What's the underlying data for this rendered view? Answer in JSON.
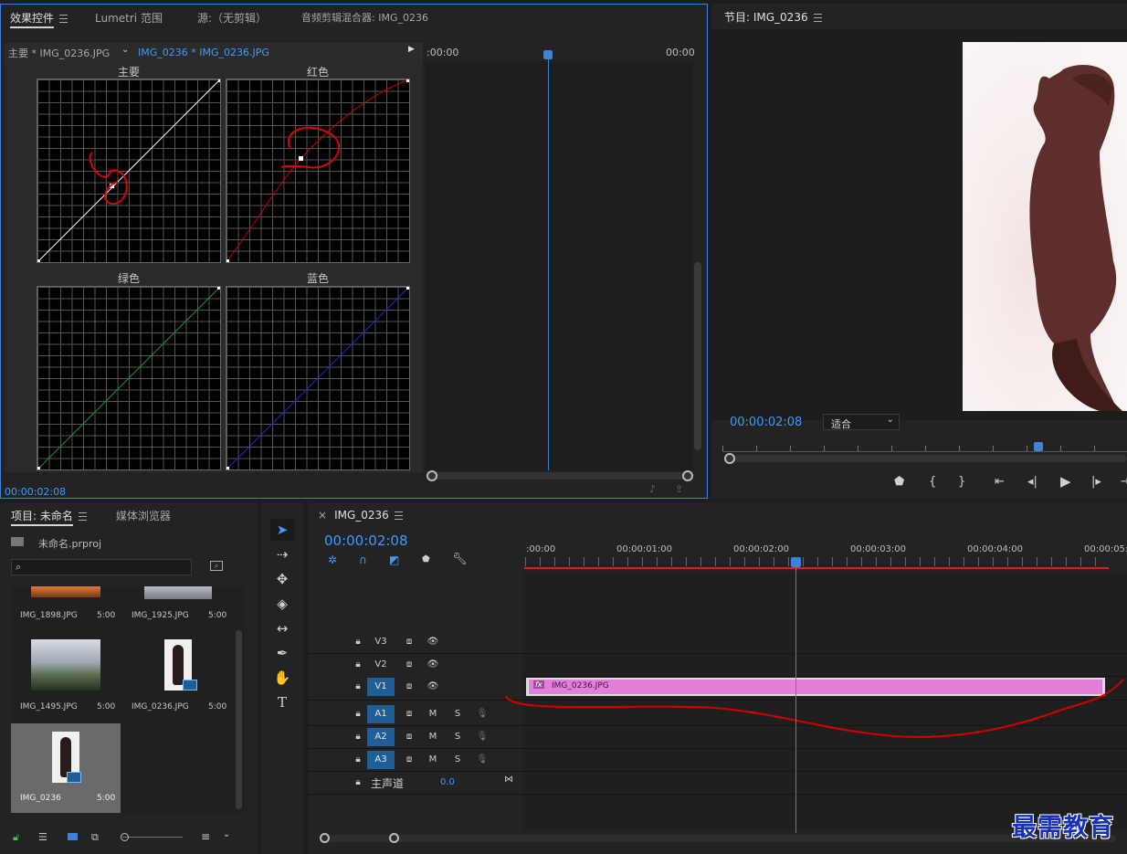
{
  "effects": {
    "tabs": [
      "效果控件",
      "Lumetri 范围",
      "源:（无剪辑）",
      "音频剪辑混合器: IMG_0236"
    ],
    "clip_master": "主要 * IMG_0236.JPG",
    "clip_selected": "IMG_0236 * IMG_0236.JPG",
    "time_left": ":00:00",
    "time_right": "00:00",
    "timecode": "00:00:02:08",
    "curves": {
      "master": "主要",
      "red": "红色",
      "green": "绿色",
      "blue": "蓝色"
    }
  },
  "program": {
    "title": "节目: IMG_0236",
    "timecode": "00:00:02:08",
    "fit_label": "适合"
  },
  "project": {
    "tabs": [
      "项目: 未命名",
      "媒体浏览器"
    ],
    "file": "未命名.prproj",
    "search_placeholder": "",
    "items": [
      {
        "name": "IMG_1898.JPG",
        "duration": "5:00"
      },
      {
        "name": "IMG_1925.JPG",
        "duration": "5:00"
      },
      {
        "name": "IMG_1495.JPG",
        "duration": "5:00"
      },
      {
        "name": "IMG_0236.JPG",
        "duration": "5:00"
      },
      {
        "name": "IMG_0236",
        "duration": "5:00"
      }
    ]
  },
  "timeline": {
    "tab": "IMG_0236",
    "close": "×",
    "timecode": "00:00:02:08",
    "ruler": [
      ":00:00",
      "00:00:01:00",
      "00:00:02:00",
      "00:00:03:00",
      "00:00:04:00",
      "00:00:05:"
    ],
    "tracks": {
      "v3": "V3",
      "v2": "V2",
      "v1": "V1",
      "a1": "A1",
      "a2": "A2",
      "a3": "A3",
      "m": "M",
      "s": "S"
    },
    "clip_name": "IMG_0236.JPG",
    "fx": "fx",
    "master_label": "主声道",
    "master_value": "0.0"
  },
  "watermark": "最需教育",
  "colors": {
    "accent": "#3f9bff",
    "clip": "#e27fdc",
    "annotation": "#d40000"
  }
}
